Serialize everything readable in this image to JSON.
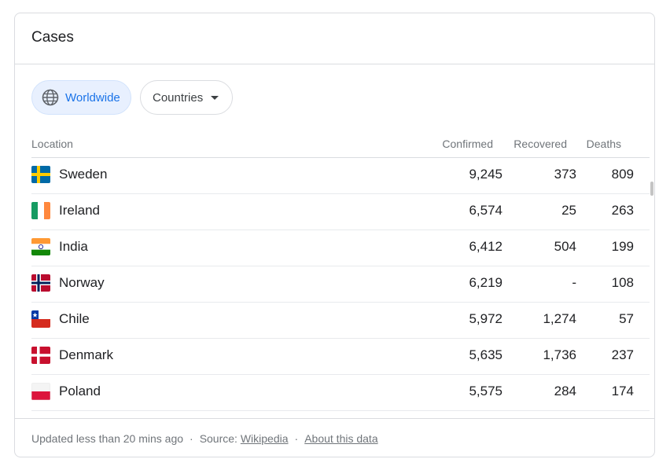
{
  "card": {
    "title": "Cases"
  },
  "filters": {
    "worldwide_label": "Worldwide",
    "countries_label": "Countries"
  },
  "table": {
    "headers": {
      "location": "Location",
      "confirmed": "Confirmed",
      "recovered": "Recovered",
      "deaths": "Deaths"
    },
    "rows": [
      {
        "country": "Sweden",
        "confirmed": "9,245",
        "recovered": "373",
        "deaths": "809",
        "flag": "sweden-flag-icon"
      },
      {
        "country": "Ireland",
        "confirmed": "6,574",
        "recovered": "25",
        "deaths": "263",
        "flag": "ireland-flag-icon"
      },
      {
        "country": "India",
        "confirmed": "6,412",
        "recovered": "504",
        "deaths": "199",
        "flag": "india-flag-icon"
      },
      {
        "country": "Norway",
        "confirmed": "6,219",
        "recovered": "-",
        "deaths": "108",
        "flag": "norway-flag-icon"
      },
      {
        "country": "Chile",
        "confirmed": "5,972",
        "recovered": "1,274",
        "deaths": "57",
        "flag": "chile-flag-icon"
      },
      {
        "country": "Denmark",
        "confirmed": "5,635",
        "recovered": "1,736",
        "deaths": "237",
        "flag": "denmark-flag-icon"
      },
      {
        "country": "Poland",
        "confirmed": "5,575",
        "recovered": "284",
        "deaths": "174",
        "flag": "poland-flag-icon"
      }
    ]
  },
  "footer": {
    "updated": "Updated less than 20 mins ago",
    "source_label": "Source:",
    "source_link": "Wikipedia",
    "about_link": "About this data",
    "separator": "·"
  },
  "colors": {
    "accent": "#1a73e8",
    "chip_bg": "#e8f0fe",
    "border": "#dadce0",
    "muted_text": "#70757a"
  }
}
